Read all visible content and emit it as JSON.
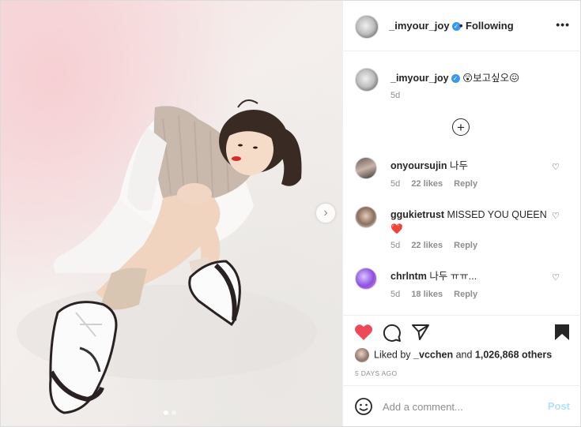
{
  "header": {
    "username": "_imyour_joy",
    "verified_mark": "✓",
    "separator": "•",
    "follow_status": "Following",
    "more_label": "•••"
  },
  "caption": {
    "username": "_imyour_joy",
    "verified_mark": "✓",
    "text": "😲보고싶오😖",
    "time": "5d",
    "load_more_label": "+"
  },
  "comments": [
    {
      "username": "onyoursujin",
      "text": "나두",
      "time": "5d",
      "likes": "22 likes",
      "reply": "Reply",
      "heart": "♡"
    },
    {
      "username": "ggukietrust",
      "text": "MISSED YOU QUEEN",
      "emoji": "❤️",
      "time": "5d",
      "likes": "22 likes",
      "reply": "Reply",
      "heart": "♡"
    },
    {
      "username": "chrlntm",
      "text": "나두 ㅠㅠ...",
      "time": "5d",
      "likes": "18 likes",
      "reply": "Reply",
      "heart": "♡"
    }
  ],
  "actions": {
    "liked_state": true,
    "saved_state": true,
    "liked_by_prefix": "Liked by",
    "liked_by_user": "_vcchen",
    "and_word": "and",
    "others": "1,026,868 others",
    "timestamp": "5 DAYS AGO"
  },
  "add_comment": {
    "placeholder": "Add a comment...",
    "post_label": "Post"
  },
  "carousel": {
    "next_label": "›",
    "slides": 2,
    "current": 1
  },
  "colors": {
    "like_red": "#ed4956",
    "verified_blue": "#3897f0",
    "post_button_disabled": "#b2dffc",
    "meta_gray": "#8e8e8e"
  },
  "icons": [
    "heart-icon",
    "comment-icon",
    "share-icon",
    "bookmark-icon",
    "emoji-icon",
    "plus-circle-icon",
    "chevron-right-icon"
  ]
}
